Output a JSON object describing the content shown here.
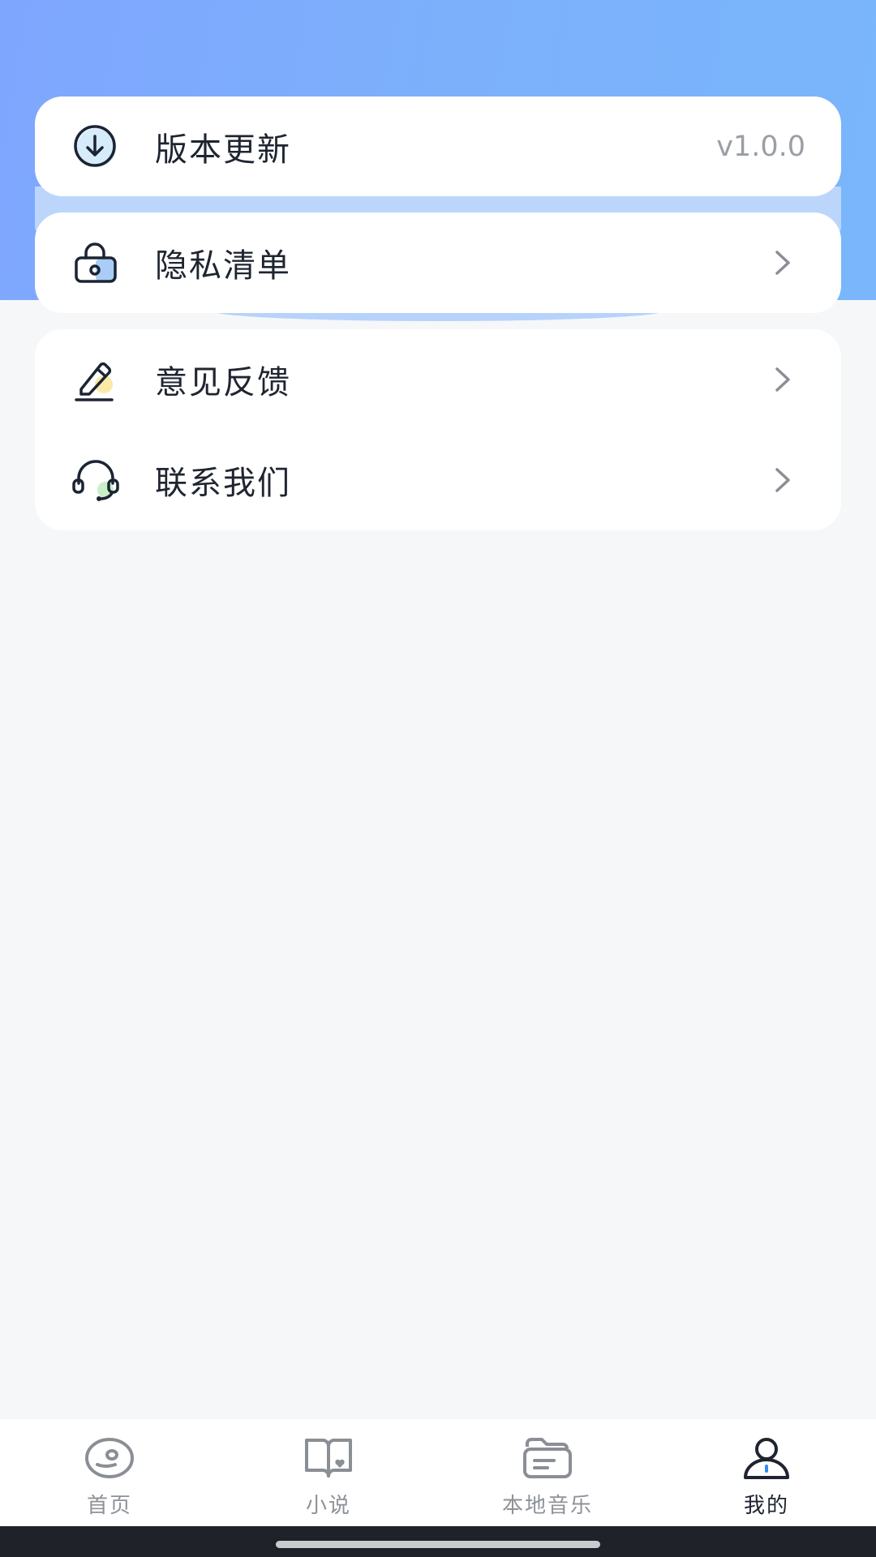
{
  "settings": {
    "version_update": {
      "label": "版本更新",
      "value": "v1.0.0",
      "icon": "download-circle-icon"
    },
    "privacy_list": {
      "label": "隐私清单",
      "icon": "lock-bag-icon"
    },
    "feedback": {
      "label": "意见反馈",
      "icon": "pen-edit-icon"
    },
    "contact_us": {
      "label": "联系我们",
      "icon": "headset-icon"
    }
  },
  "tabbar": {
    "tabs": [
      {
        "label": "首页",
        "icon": "disc-icon",
        "active": false
      },
      {
        "label": "小说",
        "icon": "book-heart-icon",
        "active": false
      },
      {
        "label": "本地音乐",
        "icon": "folder-icon",
        "active": false
      },
      {
        "label": "我的",
        "icon": "user-icon",
        "active": true
      }
    ]
  },
  "colors": {
    "header_gradient_start": "#7fa6ff",
    "header_gradient_end": "#79b6fb",
    "page_background": "#f5f7f9",
    "text_primary": "#1f2530",
    "text_secondary": "#9a9ea5",
    "accent_blue": "#2f8cf5"
  }
}
